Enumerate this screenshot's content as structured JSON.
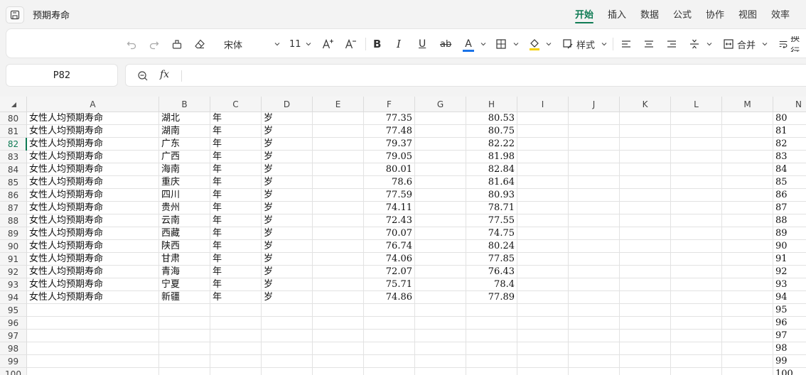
{
  "app": {
    "doc_title": "预期寿命",
    "menus": [
      "开始",
      "插入",
      "数据",
      "公式",
      "协作",
      "视图",
      "效率"
    ],
    "active_menu": "开始"
  },
  "toolbar": {
    "font_name": "宋体",
    "font_size": "11",
    "bold": "B",
    "italic": "I",
    "underline": "U",
    "strike": "ab",
    "font_color_letter": "A",
    "style_label": "样式",
    "merge_label": "合并",
    "wrap_label": "换行",
    "colors": {
      "font_color": "#1a73e8",
      "fill_color": "#f5d000"
    }
  },
  "formula_bar": {
    "cell_ref": "P82",
    "fx": "fx",
    "value": ""
  },
  "sheet": {
    "columns": [
      "A",
      "B",
      "C",
      "D",
      "E",
      "F",
      "G",
      "H",
      "I",
      "J",
      "K",
      "L",
      "M",
      "N"
    ],
    "selected_row": "82",
    "rows": [
      {
        "n": "80",
        "a": "女性人均预期寿命",
        "b": "湖北",
        "c": "年",
        "d": "岁",
        "f": "77.35",
        "h": "80.53"
      },
      {
        "n": "81",
        "a": "女性人均预期寿命",
        "b": "湖南",
        "c": "年",
        "d": "岁",
        "f": "77.48",
        "h": "80.75"
      },
      {
        "n": "82",
        "a": "女性人均预期寿命",
        "b": "广东",
        "c": "年",
        "d": "岁",
        "f": "79.37",
        "h": "82.22"
      },
      {
        "n": "83",
        "a": "女性人均预期寿命",
        "b": "广西",
        "c": "年",
        "d": "岁",
        "f": "79.05",
        "h": "81.98"
      },
      {
        "n": "84",
        "a": "女性人均预期寿命",
        "b": "海南",
        "c": "年",
        "d": "岁",
        "f": "80.01",
        "h": "82.84"
      },
      {
        "n": "85",
        "a": "女性人均预期寿命",
        "b": "重庆",
        "c": "年",
        "d": "岁",
        "f": "78.6",
        "h": "81.64"
      },
      {
        "n": "86",
        "a": "女性人均预期寿命",
        "b": "四川",
        "c": "年",
        "d": "岁",
        "f": "77.59",
        "h": "80.93"
      },
      {
        "n": "87",
        "a": "女性人均预期寿命",
        "b": "贵州",
        "c": "年",
        "d": "岁",
        "f": "74.11",
        "h": "78.71"
      },
      {
        "n": "88",
        "a": "女性人均预期寿命",
        "b": "云南",
        "c": "年",
        "d": "岁",
        "f": "72.43",
        "h": "77.55"
      },
      {
        "n": "89",
        "a": "女性人均预期寿命",
        "b": "西藏",
        "c": "年",
        "d": "岁",
        "f": "70.07",
        "h": "74.75"
      },
      {
        "n": "90",
        "a": "女性人均预期寿命",
        "b": "陕西",
        "c": "年",
        "d": "岁",
        "f": "76.74",
        "h": "80.24"
      },
      {
        "n": "91",
        "a": "女性人均预期寿命",
        "b": "甘肃",
        "c": "年",
        "d": "岁",
        "f": "74.06",
        "h": "77.85"
      },
      {
        "n": "92",
        "a": "女性人均预期寿命",
        "b": "青海",
        "c": "年",
        "d": "岁",
        "f": "72.07",
        "h": "76.43"
      },
      {
        "n": "93",
        "a": "女性人均预期寿命",
        "b": "宁夏",
        "c": "年",
        "d": "岁",
        "f": "75.71",
        "h": "78.4"
      },
      {
        "n": "94",
        "a": "女性人均预期寿命",
        "b": "新疆",
        "c": "年",
        "d": "岁",
        "f": "74.86",
        "h": "77.89"
      },
      {
        "n": "95"
      },
      {
        "n": "96"
      },
      {
        "n": "97"
      },
      {
        "n": "98"
      },
      {
        "n": "99"
      },
      {
        "n": "100"
      }
    ]
  }
}
